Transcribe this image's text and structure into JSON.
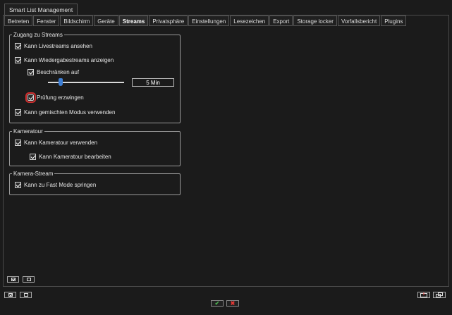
{
  "window": {
    "title": "Smart List Management"
  },
  "tabs": [
    {
      "label": "Betreten"
    },
    {
      "label": "Fenster"
    },
    {
      "label": "Bildschirm"
    },
    {
      "label": "Geräte"
    },
    {
      "label": "Streams",
      "active": true
    },
    {
      "label": "Privatsphäre"
    },
    {
      "label": "Einstellungen"
    },
    {
      "label": "Lesezeichen"
    },
    {
      "label": "Export"
    },
    {
      "label": "Storage locker"
    },
    {
      "label": "Vorfallsbericht"
    },
    {
      "label": "Plugins"
    }
  ],
  "zugang": {
    "title": "Zugang zu Streams",
    "livestreams": {
      "label": "Kann Livestreams ansehen",
      "checked": true
    },
    "wiedergabe": {
      "label": "Kann Wiedergabestreams anzeigen",
      "checked": true
    },
    "beschraenken": {
      "label": "Beschränken auf",
      "checked": true
    },
    "slider_value": "5 Min",
    "pruefung": {
      "label": "Prüfung erzwingen",
      "checked": true
    },
    "gemischt": {
      "label": "Kann gemischten Modus verwenden",
      "checked": true
    }
  },
  "kameratour": {
    "title": "Kameratour",
    "verwenden": {
      "label": "Kann Kameratour verwenden",
      "checked": true
    },
    "bearbeiten": {
      "label": "Kann Kameratour bearbeiten",
      "checked": true
    }
  },
  "kamerastream": {
    "title": "Kamera-Stream",
    "fastmode": {
      "label": "Kann zu Fast Mode springen",
      "checked": true
    }
  },
  "colors": {
    "highlight": "#d32f2f",
    "ok": "#4caf50",
    "cancel": "#e53935",
    "slider_thumb": "#3d7fd6"
  },
  "icons": {
    "ok": "check-icon",
    "cancel": "close-icon"
  },
  "footer": {
    "ok_symbol": "✔",
    "cancel_symbol": "✖"
  }
}
